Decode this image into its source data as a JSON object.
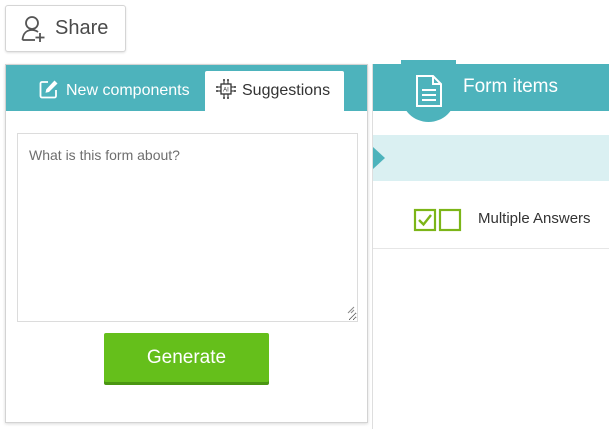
{
  "toolbar": {
    "share_label": "Share"
  },
  "left_panel": {
    "tabs": [
      {
        "label": "New components",
        "icon": "edit-icon",
        "active": false
      },
      {
        "label": "Suggestions",
        "icon": "ai-chip-icon",
        "active": true
      }
    ],
    "prompt": {
      "placeholder": "What is this form about?",
      "value": ""
    },
    "generate_label": "Generate"
  },
  "right_panel": {
    "title": "Form items",
    "title_icon": "document-icon",
    "items": [
      {
        "label": "Multiple Answers",
        "icon": "checkbox-pair-icon"
      }
    ]
  },
  "colors": {
    "accent_teal": "#4db3bc",
    "drop_zone": "#daf0f2",
    "generate_green": "#65bf1b",
    "checkbox_green": "#7cb518"
  }
}
